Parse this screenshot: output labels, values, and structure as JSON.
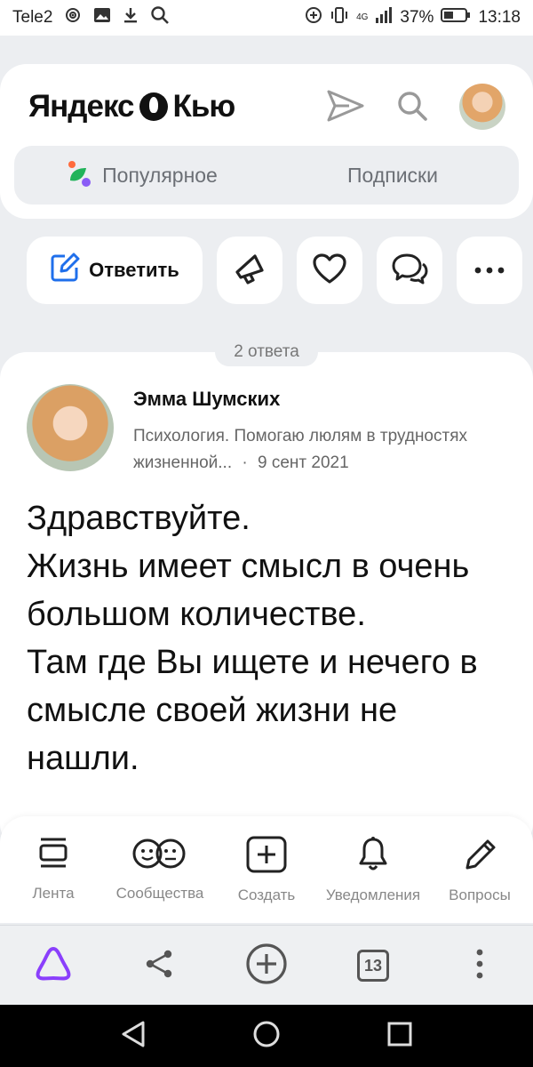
{
  "status_bar": {
    "carrier": "Tele2",
    "network": "4G",
    "battery": "37%",
    "time": "13:18"
  },
  "header": {
    "logo_left": "Яндекс",
    "logo_right": "Кью",
    "tabs": [
      {
        "label": "Популярное",
        "active": true
      },
      {
        "label": "Подписки",
        "active": false
      }
    ]
  },
  "actions": {
    "reply_label": "Ответить"
  },
  "answers_count": "2 ответа",
  "answer": {
    "author": "Эмма Шумских",
    "description": "Психология. Помогаю люлям в трудностях жизненной...",
    "separator": "·",
    "date": "9 сент 2021",
    "paragraphs": [
      "Здравствуйте.",
      "Жизнь имеет смысл в очень большом количестве.",
      "Там где Вы ищете и нечего в смысле своей жизни не нашли."
    ]
  },
  "bottom_nav": [
    {
      "label": "Лента",
      "icon": "feed-icon"
    },
    {
      "label": "Сообщества",
      "icon": "communities-icon"
    },
    {
      "label": "Создать",
      "icon": "create-icon"
    },
    {
      "label": "Уведомления",
      "icon": "bell-icon"
    },
    {
      "label": "Вопросы",
      "icon": "pencil-icon"
    }
  ],
  "browser_bar": {
    "tabs_count": "13"
  },
  "colors": {
    "background": "#eceef1",
    "card": "#ffffff",
    "accent_blue": "#1f6feb",
    "alice_purple": "#8a3ffc"
  }
}
